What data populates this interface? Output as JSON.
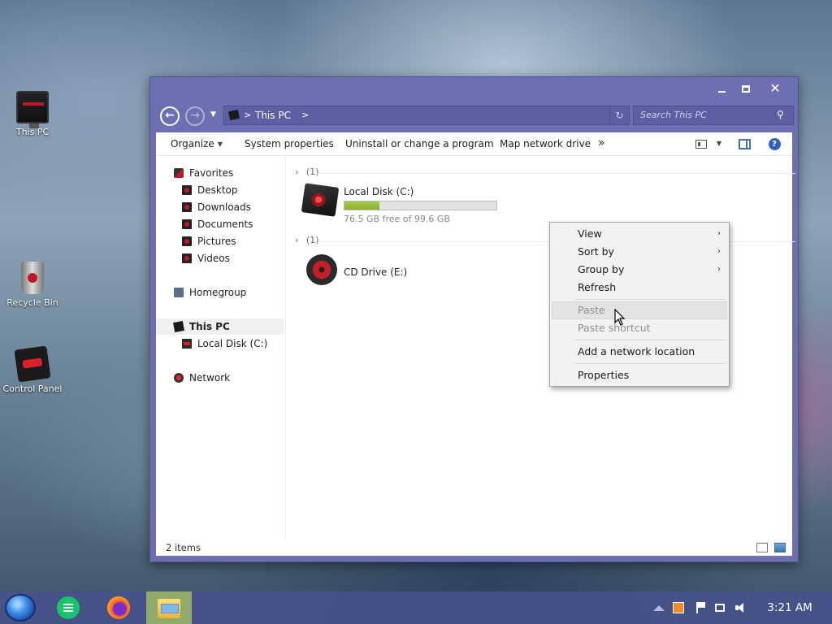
{
  "desktop": {
    "icons": [
      {
        "label": "This PC"
      },
      {
        "label": "Recycle Bin"
      },
      {
        "label": "Control Panel"
      }
    ]
  },
  "window": {
    "controls": {
      "minimize": "minimize",
      "maximize": "maximize",
      "close": "✕"
    },
    "address": {
      "separator": ">",
      "crumb": "This PC",
      "trailing": ">"
    },
    "search": {
      "placeholder": "Search This PC"
    },
    "toolbar": {
      "organize": "Organize",
      "system_properties": "System properties",
      "uninstall": "Uninstall or change a program",
      "map_drive": "Map network drive",
      "more": "»"
    },
    "nav": {
      "favorites": "Favorites",
      "desktop": "Desktop",
      "downloads": "Downloads",
      "documents": "Documents",
      "pictures": "Pictures",
      "videos": "Videos",
      "homegroup": "Homegroup",
      "this_pc": "This PC",
      "local_disk": "Local Disk (C:)",
      "network": "Network"
    },
    "groups": [
      {
        "count": "(1)"
      },
      {
        "count": "(1)"
      }
    ],
    "drives": {
      "local": {
        "name": "Local Disk (C:)",
        "free_text": "76.5 GB free of 99.6 GB",
        "used_fraction": 0.232
      },
      "cd": {
        "name": "CD Drive (E:)"
      }
    },
    "status": {
      "count": "2 items"
    }
  },
  "context_menu": {
    "view": "View",
    "sort_by": "Sort by",
    "group_by": "Group by",
    "refresh": "Refresh",
    "paste": "Paste",
    "paste_shortcut": "Paste shortcut",
    "add_network_location": "Add a network location",
    "properties": "Properties",
    "submenu_arrow": "›"
  },
  "taskbar": {
    "clock": "3:21 AM"
  },
  "colors": {
    "window_frame": "#6c6fb1",
    "progress_fill": "#8ab02e",
    "taskbar": "#46528c"
  }
}
